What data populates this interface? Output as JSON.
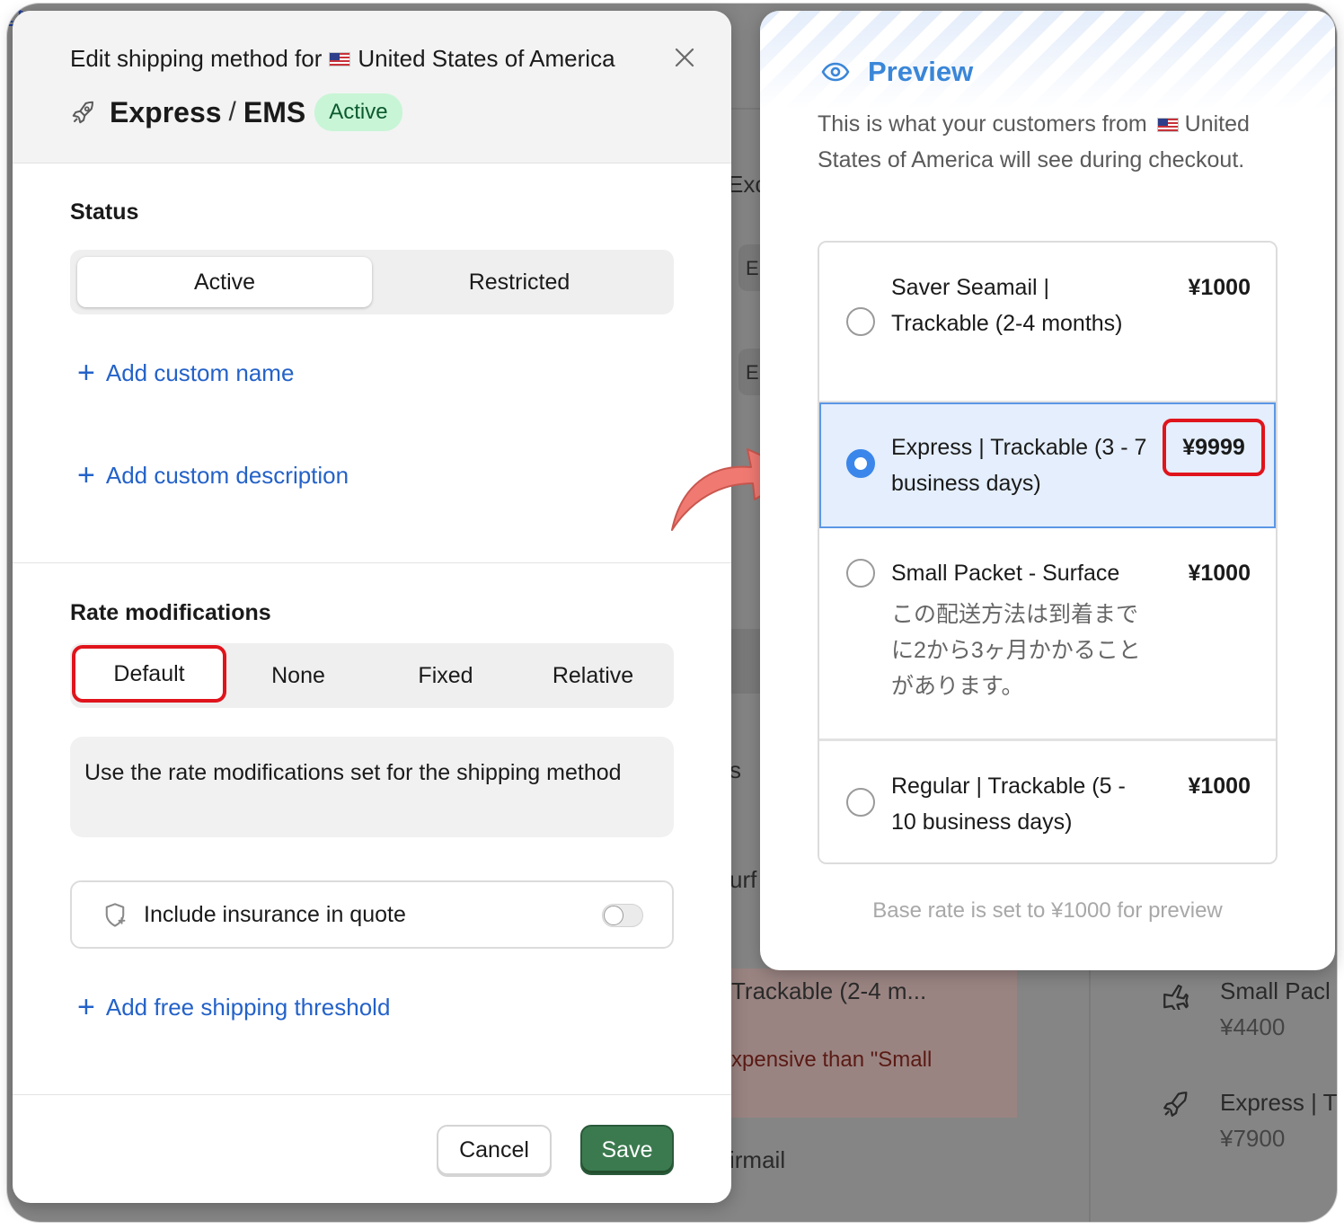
{
  "modal": {
    "title_prefix": "Edit shipping method for",
    "country": "United States of America",
    "method_name": "Express",
    "method_separator": "/",
    "method_code": "EMS",
    "status_badge": "Active",
    "status_section": {
      "title": "Status",
      "options": [
        "Active",
        "Restricted"
      ],
      "selected": "Active"
    },
    "add_custom_name": "Add custom name",
    "add_custom_description": "Add custom description",
    "rate_section": {
      "title": "Rate modifications",
      "options": [
        "Default",
        "None",
        "Fixed",
        "Relative"
      ],
      "selected": "Default",
      "description": "Use the rate modifications set for the shipping method"
    },
    "insurance": {
      "label": "Include insurance in quote",
      "enabled": false
    },
    "add_free_shipping": "Add free shipping threshold",
    "cancel_label": "Cancel",
    "save_label": "Save"
  },
  "preview": {
    "title": "Preview",
    "description_before": "This is what your customers from",
    "description_after": "United States of America will see during checkout.",
    "options": [
      {
        "label": "Saver Seamail | Trackable (2-4 months)",
        "price": "¥1000",
        "selected": false
      },
      {
        "label": "Express | Trackable (3 - 7 business days)",
        "price": "¥9999",
        "selected": true
      },
      {
        "label": "Small Packet - Surface",
        "sublabel": "この配送方法は到着までに2から3ヶ月かかることがあります。",
        "price": "¥1000",
        "selected": false
      },
      {
        "label": "Regular | Trackable (5 - 10 business days)",
        "price": "¥1000",
        "selected": false
      }
    ],
    "note": "Base rate is set to ¥1000 for preview"
  },
  "background": {
    "fragments": [
      "Exc",
      "E",
      "E",
      "urf",
      "s",
      "Trackable (2-4 m...",
      "xpensive than \"Small",
      "irmail"
    ],
    "cards": [
      {
        "name": "Small Pacl",
        "price": "¥4400"
      },
      {
        "name": "Express | T",
        "price": "¥7900"
      }
    ]
  },
  "colors": {
    "accent_blue": "#2462c8",
    "preview_blue": "#3a86d8",
    "badge_green_bg": "#c8f5d6",
    "save_green": "#3b7a4f",
    "highlight_red": "#e0141c",
    "arrow_salmon": "#f07a72"
  }
}
